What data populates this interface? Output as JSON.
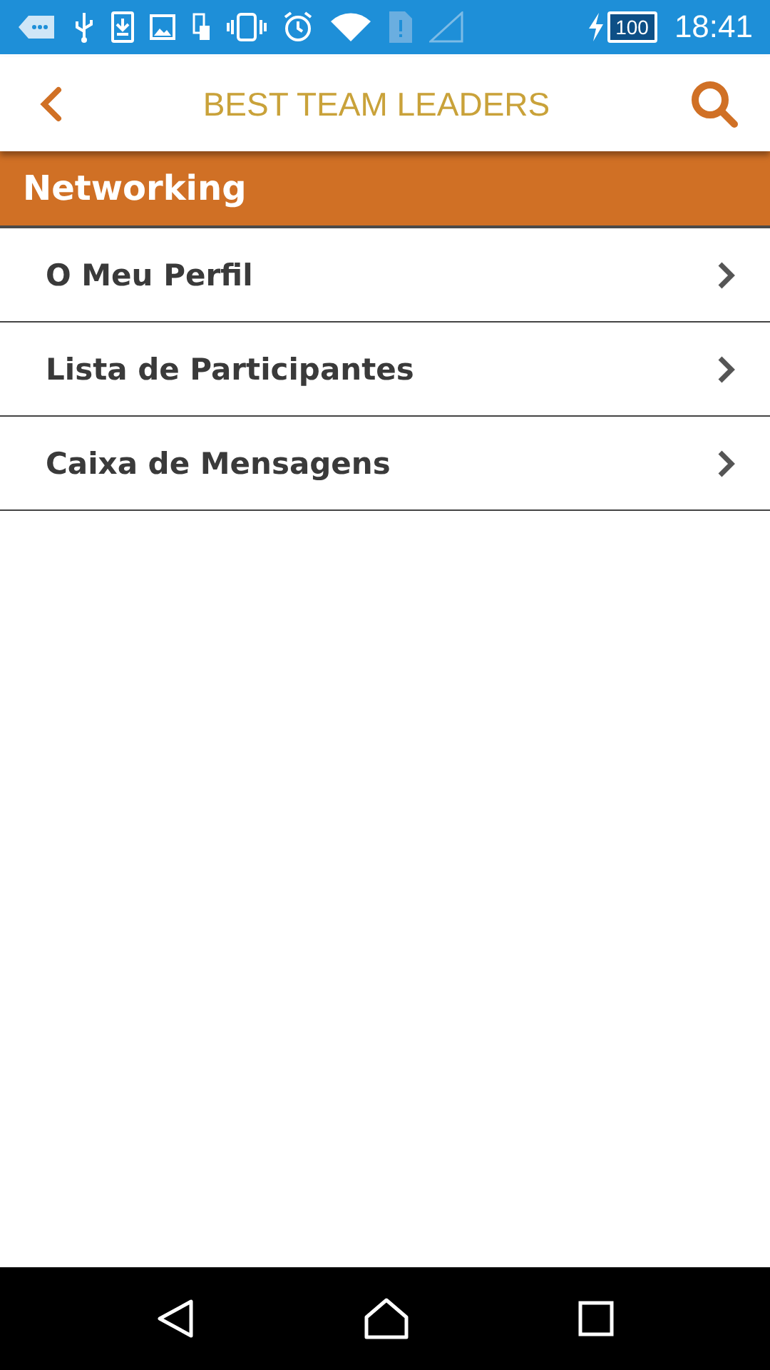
{
  "status_bar": {
    "battery": "100",
    "time": "18:41"
  },
  "header": {
    "title": "BEST TEAM LEADERS"
  },
  "section": {
    "title": "Networking"
  },
  "menu_items": [
    {
      "label": "O Meu Perfil"
    },
    {
      "label": "Lista de Participantes"
    },
    {
      "label": "Caixa de Mensagens"
    }
  ]
}
